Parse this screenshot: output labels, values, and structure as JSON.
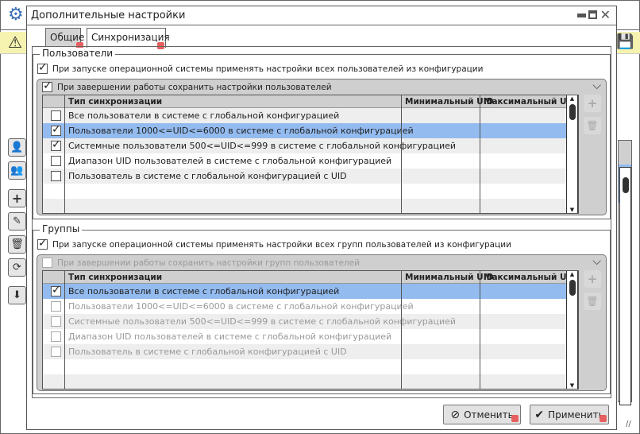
{
  "dialog": {
    "title": "Дополнительные настройки",
    "tabs": [
      {
        "label": "Общие",
        "active": false
      },
      {
        "label": "Синхронизация",
        "active": true
      }
    ]
  },
  "columns": [
    "Тип синхронизации",
    "Минимальный UID",
    "Максимальный UID"
  ],
  "users": {
    "legend": "Пользователи",
    "apply_label": "При запуске операционной системы применять настройки всех пользователей из конфигурации",
    "apply_checked": true,
    "save_label": "При завершении работы сохранить настройки пользователей",
    "save_checked": true,
    "rows": [
      {
        "label": "Все пользователи в системе с глобальной конфигурацией",
        "checked": false,
        "selected": false
      },
      {
        "label": "Пользователи 1000<=UID<=6000 в системе с глобальной конфигурацией",
        "checked": true,
        "selected": true
      },
      {
        "label": "Системные пользователи 500<=UID<=999 в системе с глобальной конфигурацией",
        "checked": true,
        "selected": false
      },
      {
        "label": "Диапазон UID пользователей в системе с глобальной конфигурацией",
        "checked": false,
        "selected": false
      },
      {
        "label": "Пользователь в системе с глобальной конфигурацией с UID",
        "checked": false,
        "selected": false
      }
    ]
  },
  "groups": {
    "legend": "Группы",
    "apply_label": "При запуске операционной системы применять настройки всех групп пользователей из конфигурации",
    "apply_checked": true,
    "save_label": "При завершении работы сохранить настройки групп пользователей",
    "save_checked": false,
    "rows": [
      {
        "label": "Все пользователи в системе с глобальной конфигурацией",
        "checked": true,
        "selected": true
      },
      {
        "label": "Пользователи 1000<=UID<=6000 в системе с глобальной конфигурацией",
        "checked": false,
        "selected": false
      },
      {
        "label": "Системные пользователи 500<=UID<=999 в системе с глобальной конфигурацией",
        "checked": false,
        "selected": false
      },
      {
        "label": "Диапазон UID пользователей в системе с глобальной конфигурацией",
        "checked": false,
        "selected": false
      },
      {
        "label": "Пользователь в системе с глобальной конфигурацией с UID",
        "checked": false,
        "selected": false
      }
    ]
  },
  "buttons": {
    "cancel": "Отменить",
    "apply": "Применить"
  },
  "colors": {
    "selection": "#93bbef",
    "warning_bar": "#f6f3b0",
    "pin": "#e76060"
  }
}
